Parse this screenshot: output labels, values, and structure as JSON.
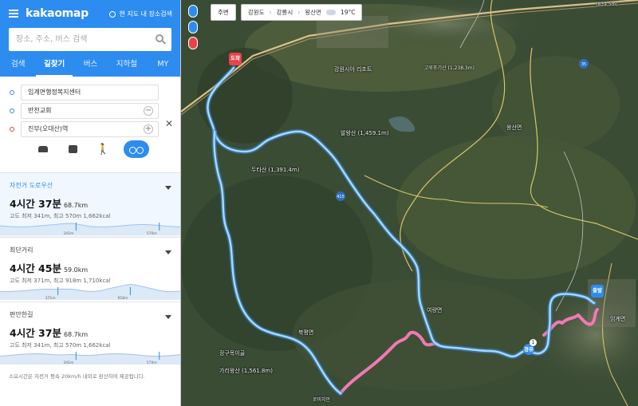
{
  "app": {
    "logo": "kakaomap",
    "nearby_label": "현 지도 내 장소검색",
    "search_placeholder": "장소, 주소, 버스 검색"
  },
  "tabs": [
    {
      "label": "검색"
    },
    {
      "label": "길찾기"
    },
    {
      "label": "버스"
    },
    {
      "label": "지하철"
    },
    {
      "label": "MY"
    }
  ],
  "route": {
    "start": "임계면행정복지센터",
    "via": "반천교회",
    "end": "진부(오대산)역",
    "via_btn": "−",
    "end_btn": "+",
    "close": "✕"
  },
  "options": [
    {
      "name": "자전거 도로우선",
      "hours": "4시간 37분",
      "distance": "68.7km",
      "detail": "고도 최저 341m, 최고 570m    1,662kcal",
      "low_label": "341m",
      "high_label": "570m",
      "low_pos": 0.42,
      "high_pos": 0.88
    },
    {
      "name": "최단거리",
      "hours": "4시간 45분",
      "distance": "59.0km",
      "detail": "고도 최저 371m, 최고 918m    1,710kcal",
      "low_label": "371m",
      "high_label": "918m",
      "low_pos": 0.32,
      "high_pos": 0.72
    },
    {
      "name": "편안한길",
      "hours": "4시간 37분",
      "distance": "68.7km",
      "detail": "고도 최저 341m, 최고 570m    1,662kcal",
      "low_label": "341m",
      "high_label": "570m",
      "low_pos": 0.42,
      "high_pos": 0.88
    }
  ],
  "note": "소요시간은 자전거 평속 20km/h 내외로 환산하여 제공됩니다.",
  "map": {
    "nearby_btn": "주변",
    "breadcrumb": [
      "강원도",
      "강릉시",
      "왕산면"
    ],
    "temperature": "19°C",
    "marker_end": "도착",
    "marker_start": "출발",
    "marker_via": "경유",
    "via_number": "1",
    "side_pins": [
      "출",
      "경",
      "도"
    ],
    "labels": [
      {
        "text": "강원시아 리조트"
      },
      {
        "text": "발왕산 (1,459.1m)"
      },
      {
        "text": "고루포기산 (1,238.3m)"
      },
      {
        "text": "두타산 (1,391.4m)"
      },
      {
        "text": "왕산면"
      },
      {
        "text": "여량면"
      },
      {
        "text": "북평면"
      },
      {
        "text": "장구목이골"
      },
      {
        "text": "가리왕산 (1,561.8m)"
      },
      {
        "text": "임계면"
      },
      {
        "text": "로미치안"
      },
      {
        "text": "(839.5m)"
      },
      {
        "text": "415"
      },
      {
        "text": "35"
      }
    ]
  },
  "colors": {
    "brand": "#2d8cf0",
    "route_bike": "#62b4f3",
    "route_alt": "#f07ab4",
    "end_marker": "#e8434a"
  }
}
